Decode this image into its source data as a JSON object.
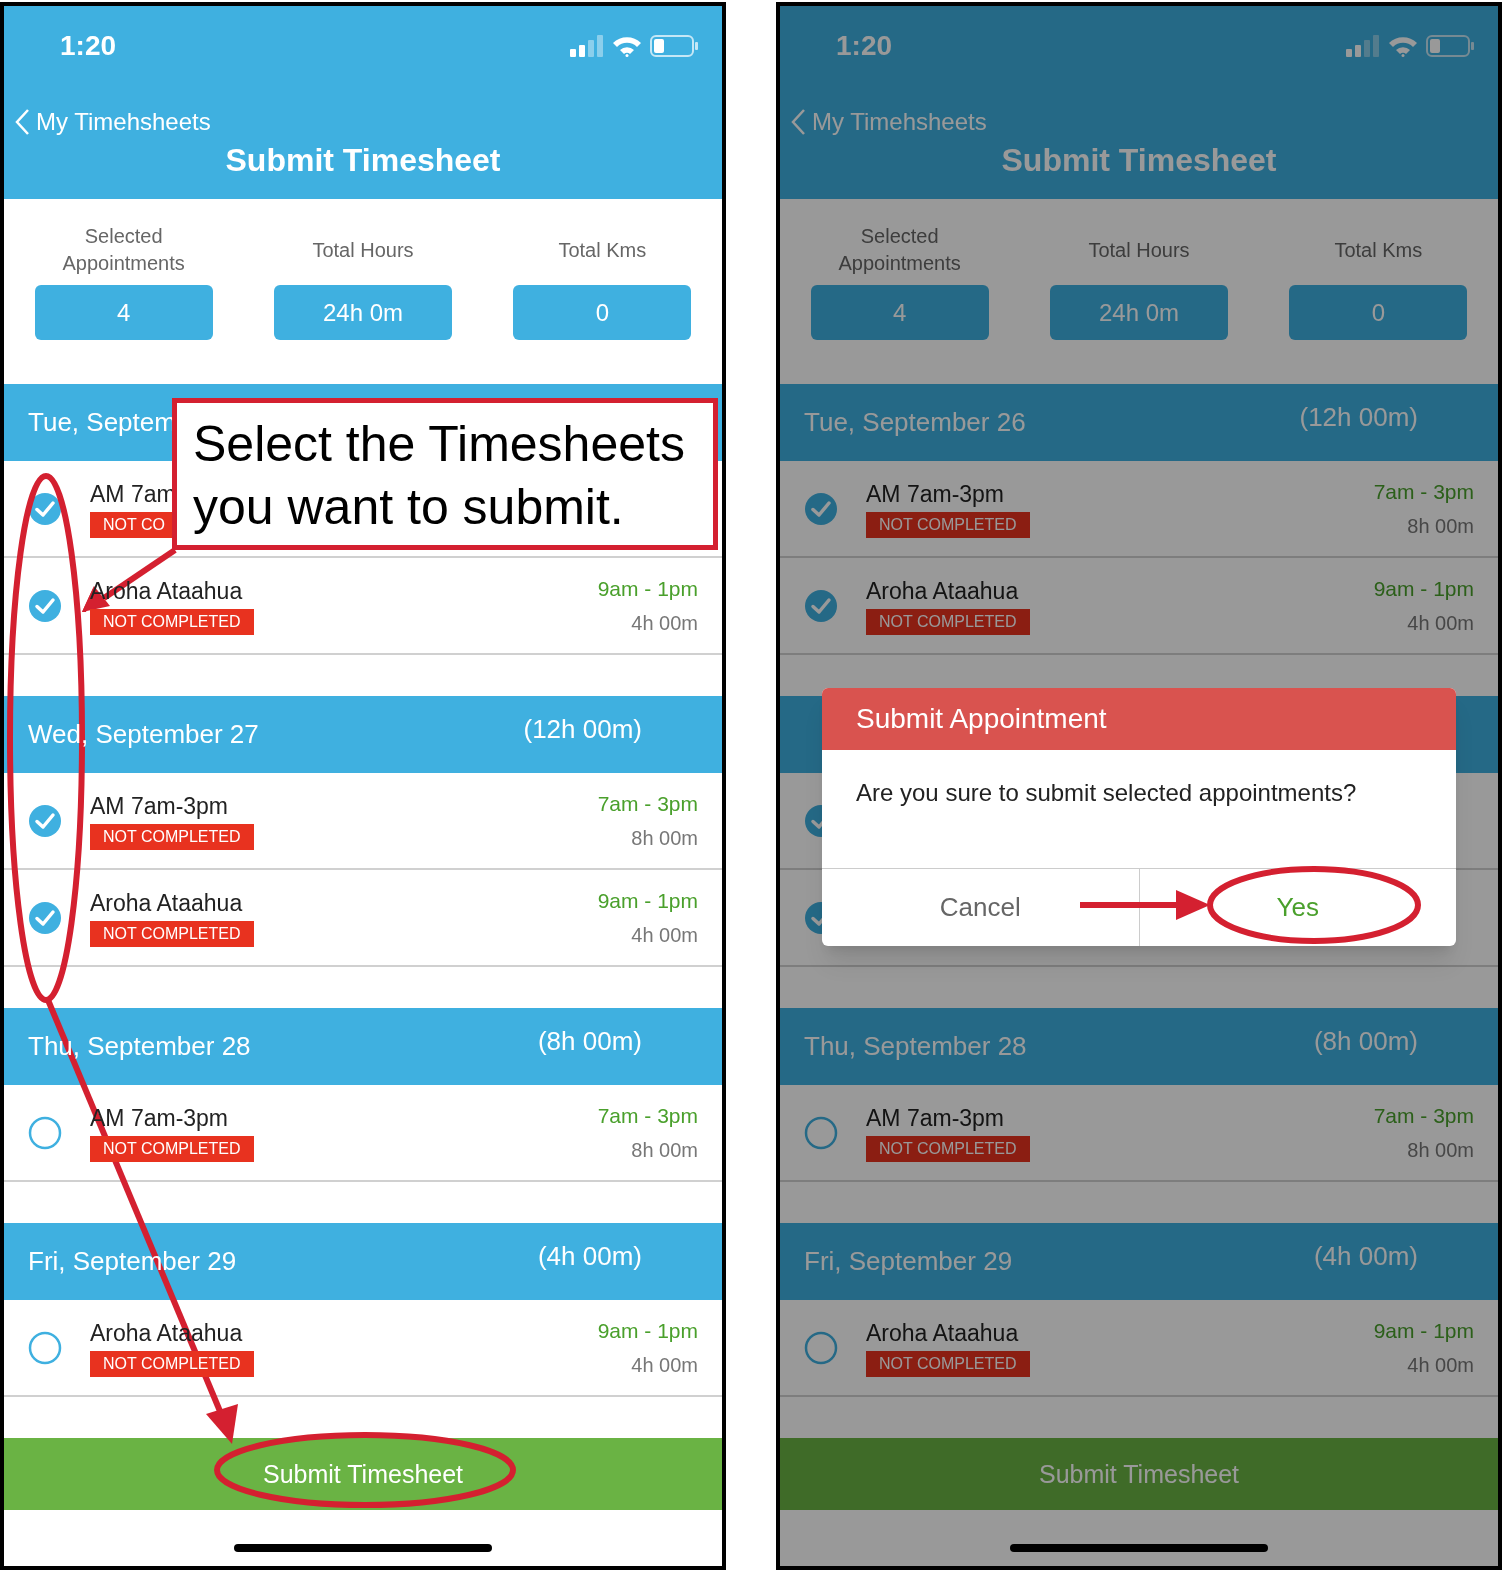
{
  "screens": [
    {
      "dimmed": false,
      "status_bar": {
        "time": "1:20"
      },
      "nav": {
        "back": "My Timehsheets",
        "title": "Submit Timesheet"
      },
      "summary": [
        {
          "label": "Selected Appointments",
          "value": "4"
        },
        {
          "label": "Total Hours",
          "value": "24h 0m"
        },
        {
          "label": "Total Kms",
          "value": "0"
        }
      ],
      "days": [
        {
          "label": "Tue, Septem",
          "rows": [
            {
              "selected": true,
              "title": "AM 7am",
              "status": "NOT CO"
            },
            {
              "selected": true,
              "title": "Aroha Ataahua",
              "status": "NOT COMPLETED",
              "time": "9am - 1pm",
              "duration": "4h 00m"
            }
          ]
        },
        {
          "label": "Wed, September 27",
          "total": "(12h 00m)",
          "rows": [
            {
              "selected": true,
              "title": "AM 7am-3pm",
              "status": "NOT COMPLETED",
              "time": "7am - 3pm",
              "duration": "8h 00m"
            },
            {
              "selected": true,
              "title": "Aroha Ataahua",
              "status": "NOT COMPLETED",
              "time": "9am - 1pm",
              "duration": "4h 00m"
            }
          ]
        },
        {
          "label": "Thu, September 28",
          "total": "(8h 00m)",
          "rows": [
            {
              "selected": false,
              "title": "AM 7am-3pm",
              "status": "NOT COMPLETED",
              "time": "7am - 3pm",
              "duration": "8h 00m"
            }
          ]
        },
        {
          "label": "Fri, September 29",
          "total": "(4h 00m)",
          "rows": [
            {
              "selected": false,
              "title": "Aroha Ataahua",
              "status": "NOT COMPLETED",
              "time": "9am - 1pm",
              "duration": "4h 00m"
            }
          ]
        }
      ],
      "submit": "Submit Timesheet"
    },
    {
      "dimmed": true,
      "status_bar": {
        "time": "1:20"
      },
      "nav": {
        "back": "My Timehsheets",
        "title": "Submit Timesheet"
      },
      "summary": [
        {
          "label": "Selected Appointments",
          "value": "4"
        },
        {
          "label": "Total Hours",
          "value": "24h 0m"
        },
        {
          "label": "Total Kms",
          "value": "0"
        }
      ],
      "days": [
        {
          "label": "Tue, September 26",
          "total": "(12h 00m)",
          "rows": [
            {
              "selected": true,
              "title": "AM 7am-3pm",
              "status": "NOT COMPLETED",
              "time": "7am - 3pm",
              "duration": "8h 00m"
            },
            {
              "selected": true,
              "title": "Aroha Ataahua",
              "status": "NOT COMPLETED",
              "time": "9am - 1pm",
              "duration": "4h 00m"
            }
          ]
        },
        {
          "rows": [
            {
              "selected": true
            },
            {
              "selected": true
            }
          ]
        },
        {
          "label": "Thu, September 28",
          "total": "(8h 00m)",
          "rows": [
            {
              "selected": false,
              "title": "AM 7am-3pm",
              "status": "NOT COMPLETED",
              "time": "7am - 3pm",
              "duration": "8h 00m"
            }
          ]
        },
        {
          "label": "Fri, September 29",
          "total": "(4h 00m)",
          "rows": [
            {
              "selected": false,
              "title": "Aroha Ataahua",
              "status": "NOT COMPLETED",
              "time": "9am - 1pm",
              "duration": "4h 00m"
            }
          ]
        }
      ],
      "submit": "Submit Timesheet",
      "dialog": {
        "title": "Submit Appointment",
        "message": "Are you sure to submit selected appointments?",
        "buttons": [
          "Cancel",
          "Yes"
        ]
      }
    }
  ],
  "annotations": {
    "callout": "Select the Timesheets you want to submit."
  }
}
